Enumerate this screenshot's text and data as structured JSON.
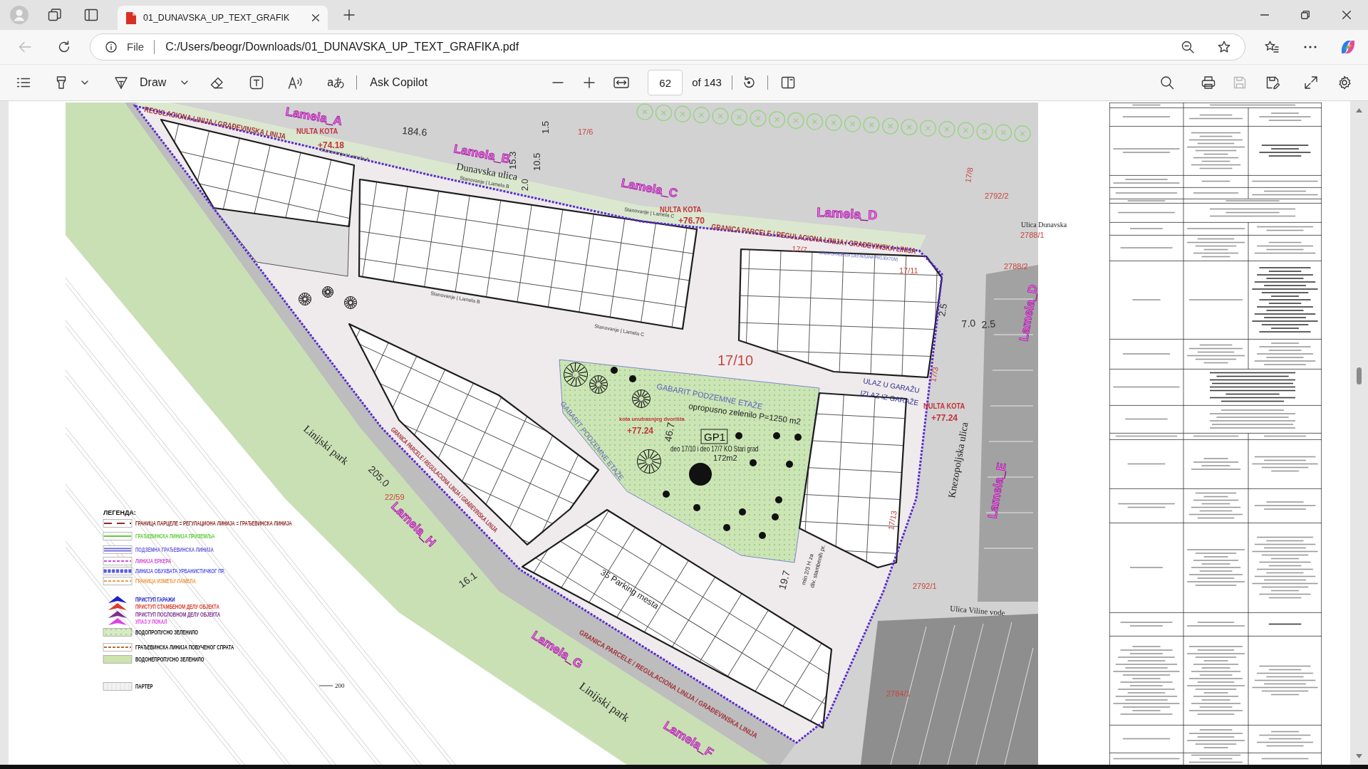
{
  "browser": {
    "tabs": [
      {
        "title": "01_DUNAVSKA_UP_TEXT_GRAFIK",
        "selected": true
      }
    ],
    "back_disabled": true,
    "address": {
      "scheme": "File",
      "url": "C:/Users/beogr/Downloads/01_DUNAVSKA_UP_TEXT_GRAFIKA.pdf"
    }
  },
  "pdf_toolbar": {
    "draw": "Draw",
    "translate": "aあ",
    "ask": "Ask Copilot",
    "page": "62",
    "page_total": "of 143",
    "save_disabled": true
  },
  "plan": {
    "labels": [
      {
        "text": "Lamela_A",
        "kind": "lamela"
      },
      {
        "text": "REGULACIONA LINIJA / GRAĐEVINSKA LINIJA",
        "kind": "boundary"
      },
      {
        "text": "NULTA KOTA",
        "kind": "kota"
      },
      {
        "text": "+74.18",
        "kind": "kota"
      },
      {
        "text": "184.6",
        "kind": "dimension"
      },
      {
        "text": "1.5",
        "kind": "dimension"
      },
      {
        "text": "17/6",
        "kind": "parcel"
      },
      {
        "text": "Stanovanje | Lamela A",
        "kind": "small"
      },
      {
        "text": "Lamela_B",
        "kind": "lamela"
      },
      {
        "text": "Dunavska ulica",
        "kind": "street"
      },
      {
        "text": "15.3",
        "kind": "dimension"
      },
      {
        "text": "10.5",
        "kind": "dimension"
      },
      {
        "text": "2.0",
        "kind": "dimension"
      },
      {
        "text": "Stanovanje | Lamela B",
        "kind": "small"
      },
      {
        "text": "Lamela_C",
        "kind": "lamela"
      },
      {
        "text": "Stanovanje | Lamela C",
        "kind": "small"
      },
      {
        "text": "NULTA KOTA",
        "kind": "kota"
      },
      {
        "text": "+76.70",
        "kind": "kota"
      },
      {
        "text": "GRANICA PARCELE / REGULACIONA LINIJA / GRAĐEVINSKA LINIJA",
        "kind": "boundary"
      },
      {
        "text": "Lamela_D",
        "kind": "lamela"
      },
      {
        "text": "17/7",
        "kind": "parcel"
      },
      {
        "text": "LINIJA GRAĐENJA (DEFINISANA PROJEKTOM)",
        "kind": "gabarit"
      },
      {
        "text": "17/8",
        "kind": "parcel"
      },
      {
        "text": "2792/2",
        "kind": "parcel"
      },
      {
        "text": "Ulica Dunavska",
        "kind": "street"
      },
      {
        "text": "2788/1",
        "kind": "parcel"
      },
      {
        "text": "2788/2",
        "kind": "parcel"
      },
      {
        "text": "17/11",
        "kind": "parcel"
      },
      {
        "text": "Lamela_D",
        "kind": "lamela"
      },
      {
        "text": "2.5",
        "kind": "dimension"
      },
      {
        "text": "7.0",
        "kind": "dimension"
      },
      {
        "text": "2.5",
        "kind": "dimension"
      },
      {
        "text": "Stanovanje | Lamela B",
        "kind": "small"
      },
      {
        "text": "Stanovanje | Lamela C",
        "kind": "small"
      },
      {
        "text": "17/10",
        "kind": "parcel"
      },
      {
        "text": "17/3",
        "kind": "parcel"
      },
      {
        "text": "ULAZ U GARAŽU",
        "kind": "garage"
      },
      {
        "text": "IZLAZ IZ GARAŽE",
        "kind": "garage"
      },
      {
        "text": "GABARIT PODZEMNE ETAŽE",
        "kind": "gabarit"
      },
      {
        "text": "NULTA KOTA",
        "kind": "kota"
      },
      {
        "text": "+77.24",
        "kind": "kota"
      },
      {
        "text": "opropusno zelenilo P=1250 m2",
        "kind": "note"
      },
      {
        "text": "kota unutrasnjeg dvorišta",
        "kind": "kota"
      },
      {
        "text": "+77.24",
        "kind": "kota"
      },
      {
        "text": "GABARIT PODZEMNE ETAŽE",
        "kind": "gabarit"
      },
      {
        "text": "46.7",
        "kind": "dimension"
      },
      {
        "text": "GP1",
        "kind": "tag"
      },
      {
        "text": "deo 17/10 i deo 17/7 KO Stari grad",
        "kind": "note"
      },
      {
        "text": "172m2",
        "kind": "note"
      },
      {
        "text": "Linijski park",
        "kind": "street"
      },
      {
        "text": "Knezopoljska ulica",
        "kind": "street"
      },
      {
        "text": "205.0",
        "kind": "dimension"
      },
      {
        "text": "GRANICA PARCELE / REGULACIONA LINIJA / GRAĐEVINSKA LINIJA",
        "kind": "boundary"
      },
      {
        "text": "22/59",
        "kind": "parcel"
      },
      {
        "text": "Lamela_H",
        "kind": "lamela"
      },
      {
        "text": "Lamela_E",
        "kind": "lamela"
      },
      {
        "text": "17/13",
        "kind": "parcel"
      },
      {
        "text": "19.7",
        "kind": "dimension"
      },
      {
        "text": "min 2/3 H za",
        "kind": "note"
      },
      {
        "text": "div. stambenih pr.",
        "kind": "note"
      },
      {
        "text": "35 Parking mesta",
        "kind": "note"
      },
      {
        "text": "16.1",
        "kind": "dimension"
      },
      {
        "text": "2792/1",
        "kind": "parcel"
      },
      {
        "text": "Ulica Viline vode",
        "kind": "street"
      },
      {
        "text": "GRANICA PARCELE / REGULACIONA LINIJA / GRAĐEVINSKA LINIJA",
        "kind": "boundary"
      },
      {
        "text": "Lamela_G",
        "kind": "lamela"
      },
      {
        "text": "Linijski park",
        "kind": "street"
      },
      {
        "text": "2784/1",
        "kind": "parcel"
      },
      {
        "text": "Lamela_F",
        "kind": "lamela"
      }
    ],
    "legend": {
      "title": "ЛЕГЕНДА:",
      "items": [
        {
          "text": "ГРАНИЦА ПАРЦЕЛЕ = РЕГУЛАЦИОНА ЛИНИЈА = ГРАЂЕВИНСКА ЛИНИЈА",
          "kind": "dash",
          "color": "#8b2a2a"
        },
        {
          "text": "ГРАЂЕВИНСКА ЛИНИЈА ПРИЗЕМЉА",
          "kind": "solid",
          "color": "#5fcf3c"
        },
        {
          "text": "ПОДЗЕМНА ГРАЂЕВИНСКА ЛИНИЈА",
          "kind": "double",
          "color": "#6a64d8"
        },
        {
          "text": "ЛИНИЈА ЕРКЕРА",
          "kind": "thin-dash",
          "color": "#d84ad8"
        },
        {
          "text": "ЛИНИЈА ОБУХВАТА УРБАНИСТИЧКОГ ПР.",
          "kind": "dots",
          "color": "#5a5ae6"
        },
        {
          "text": "ГРАНИЦА ИЗМЕЂУ ЛАМЕЛА",
          "kind": "thin-dash",
          "color": "#ee9a45"
        },
        {
          "text": "ПРИСТУП ГАРАЖИ",
          "kind": "arrow",
          "color": "#2020c8"
        },
        {
          "text": "ПРИСТУП СТАМБЕНОМ ДЕЛУ ОБЈЕКТА",
          "kind": "arrow",
          "color": "#e03a28"
        },
        {
          "text": "ПРИСТУП ПОСЛОВНОМ ДЕЛУ ОБЈЕКТА",
          "kind": "arrow",
          "color": "#7a3090"
        },
        {
          "text": "УЛАЗ У ЛОКАЛ",
          "kind": "arrow",
          "color": "#e040e8"
        },
        {
          "text": "ВОДОПРОПУСНО ЗЕЛЕНИЛО",
          "kind": "dotted-fill",
          "color": "#d6eac4"
        },
        {
          "text": "ГРАЂЕВИНСКА ЛИНИЈА ПОВУЧЕНОГ СПРАТА",
          "kind": "plain-dash",
          "color": "#c0682a"
        },
        {
          "text": "ВОДОНЕПРОПУСНО ЗЕЛЕНИЛО",
          "kind": "fill",
          "color": "#cde3b0"
        },
        {
          "text": "ПАРТЕР",
          "kind": "grid",
          "color": "#f2f2f2"
        }
      ]
    },
    "scale": "200"
  }
}
